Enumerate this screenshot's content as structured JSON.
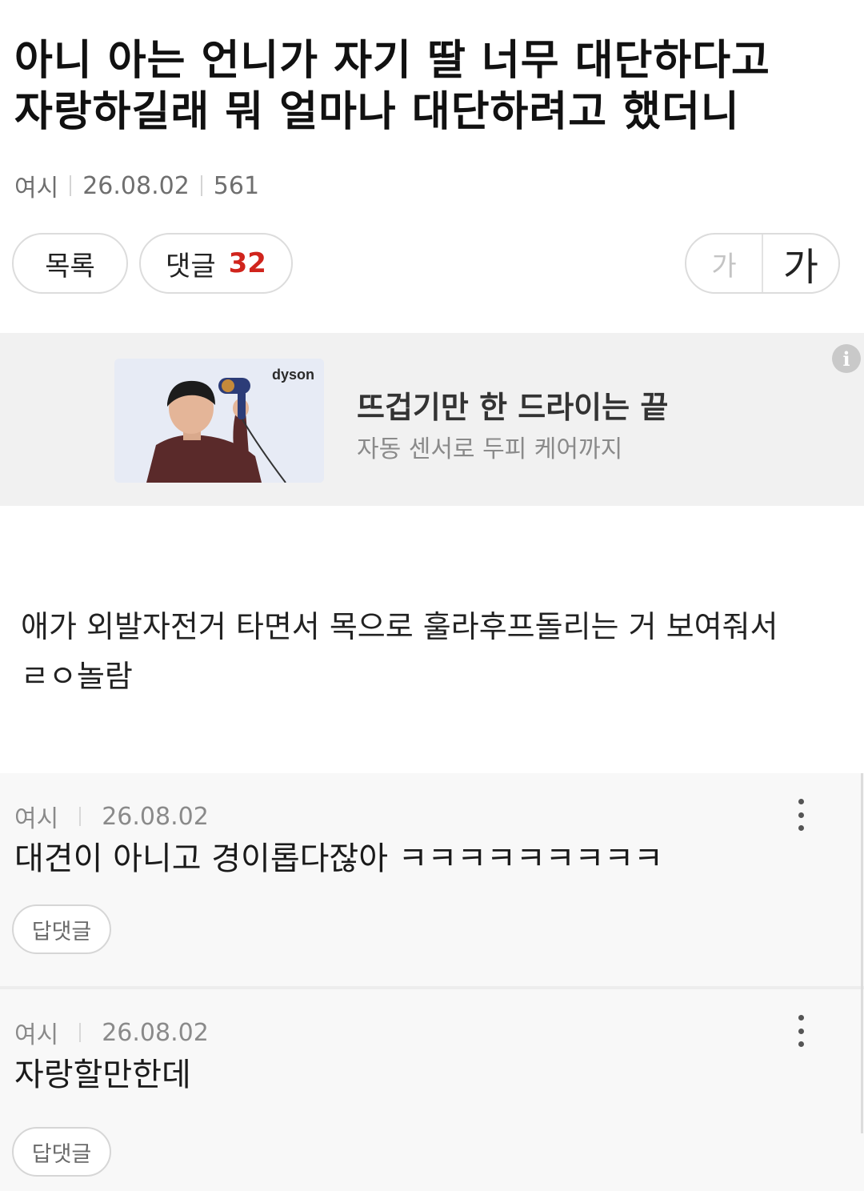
{
  "post": {
    "title_line1": "아니 아는 언니가 자기 딸 너무 대단하다고",
    "title_line2": "자랑하길래 뭐 얼마나 대단하려고 했더니",
    "author": "여시",
    "date": "26.08.02",
    "views": "561",
    "body_line1": "애가 외발자전거 타면서 목으로 훌라후프돌리는 거 보여줘서",
    "body_line2": "ㄹㅇ놀람"
  },
  "toolbar": {
    "list_label": "목록",
    "comments_label": "댓글",
    "comments_count": "32",
    "font_small": "가",
    "font_large": "가"
  },
  "ad": {
    "brand": "dyson",
    "headline": "뜨겁기만 한 드라이는 끝",
    "subline": "자동 센서로 두피 케어까지",
    "info_icon": "info-icon"
  },
  "comments": [
    {
      "author": "여시",
      "date": "26.08.02",
      "text": "대견이 아니고 경이롭다잖아 ㅋㅋㅋㅋㅋㅋㅋㅋㅋ",
      "reply_label": "답댓글"
    },
    {
      "author": "여시",
      "date": "26.08.02",
      "text": "자랑할만한데",
      "reply_label": "답댓글"
    }
  ],
  "colors": {
    "accent_count": "#d0241c",
    "ad_background": "#f1f1f1",
    "comment_background": "#f8f8f8"
  }
}
